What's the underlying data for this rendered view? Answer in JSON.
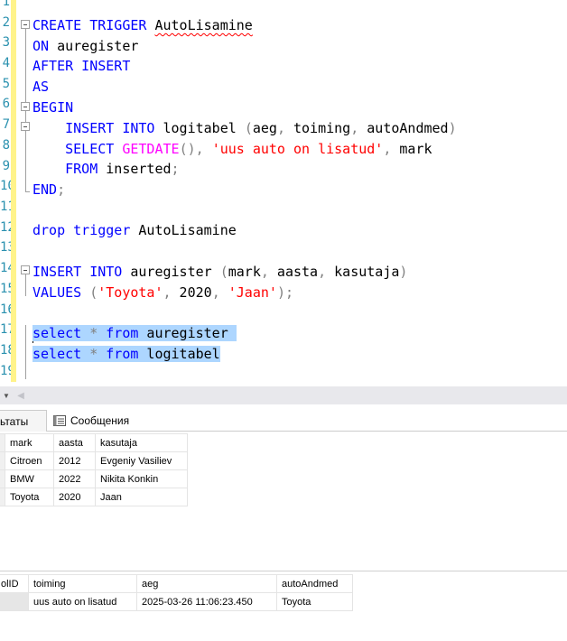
{
  "editor": {
    "line_numbers": [
      "1",
      "2",
      "3",
      "4",
      "5",
      "6",
      "7",
      "8",
      "9",
      "10",
      "11",
      "12",
      "13",
      "14",
      "15",
      "16",
      "17",
      "18",
      "19"
    ],
    "lines": {
      "l2": {
        "kw": "CREATE TRIGGER",
        "name": "AutoLisamine"
      },
      "l3": {
        "kw": "ON",
        "text": " auregister"
      },
      "l4": {
        "kw": "AFTER INSERT"
      },
      "l5": {
        "kw": "AS"
      },
      "l6": {
        "kw": "BEGIN"
      },
      "l7": {
        "kw": "    INSERT INTO",
        "text": " logitabel ",
        "op1": "(",
        "text2": "aeg",
        "op2": ",",
        "text3": " toiming",
        "op3": ",",
        "text4": " autoAndmed",
        "op4": ")"
      },
      "l8": {
        "kw": "    SELECT",
        "fn": "GETDATE",
        "op1": "(),",
        "str": "'uus auto on lisatud'",
        "op2": ",",
        "text": " mark"
      },
      "l9": {
        "kw": "    FROM",
        "text": " inserted",
        "op": ";"
      },
      "l10": {
        "kw": "END",
        "op": ";"
      },
      "l12": {
        "kw": "drop trigger",
        "text": " AutoLisamine"
      },
      "l14": {
        "kw": "INSERT INTO",
        "text": " auregister ",
        "op1": "(",
        "text2": "mark",
        "op2": ",",
        "text3": " aasta",
        "op3": ",",
        "text4": " kasutaja",
        "op4": ")"
      },
      "l15": {
        "kw": "VALUES",
        "op1": " (",
        "str1": "'Toyota'",
        "op2": ",",
        "num": " 2020",
        "op3": ",",
        "str2": " 'Jaan'",
        "op4": ");"
      },
      "l17": {
        "kw1": "select",
        "op": " *",
        "kw2": " from",
        "text": " auregister "
      },
      "l18": {
        "kw1": "select",
        "op": " *",
        "kw2": " from",
        "text": " logitabel"
      }
    }
  },
  "tabs": {
    "results": "льтаты",
    "messages": "Сообщения"
  },
  "grid1": {
    "headers": [
      "mark",
      "aasta",
      "kasutaja"
    ],
    "rows": [
      [
        "Citroen",
        "2012",
        "Evgeniy Vasiliev"
      ],
      [
        "BMW",
        "2022",
        "Nikita Konkin"
      ],
      [
        "Toyota",
        "2020",
        "Jaan"
      ]
    ]
  },
  "grid2": {
    "headers": [
      "olID",
      "toiming",
      "aeg",
      "autoAndmed"
    ],
    "rows": [
      [
        "",
        "uus auto on lisatud",
        "2025-03-26 11:06:23.450",
        "Toyota"
      ]
    ]
  },
  "colors": {
    "keyword": "#0000ff",
    "function": "#ff00ff",
    "string": "#ff0000",
    "operator": "#808080",
    "line_number": "#2b91af",
    "selection": "#add6ff",
    "change_marker": "#fff38a"
  }
}
